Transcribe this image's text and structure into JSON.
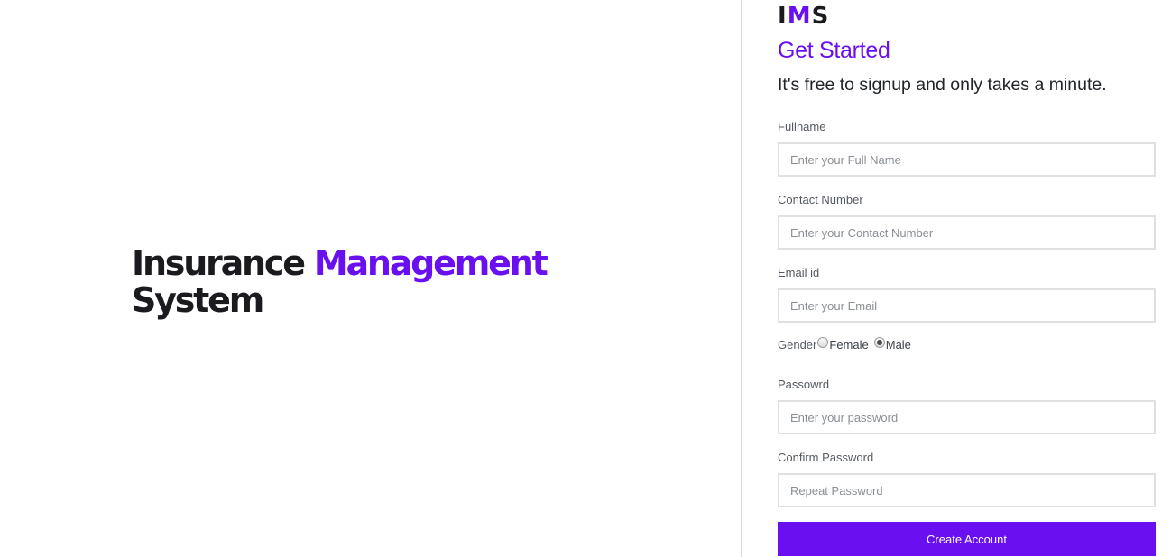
{
  "hero": {
    "title_part1": "Insurance",
    "title_accent": "Management",
    "title_part2": "System"
  },
  "logo": {
    "letter1": "I",
    "letter2": "M",
    "letter3": "S"
  },
  "form": {
    "title": "Get Started",
    "subtitle": "It's free to signup and only takes a minute.",
    "fullname": {
      "label": "Fullname",
      "placeholder": "Enter your Full Name",
      "value": ""
    },
    "contact": {
      "label": "Contact Number",
      "placeholder": "Enter your Contact Number",
      "value": ""
    },
    "email": {
      "label": "Email id",
      "placeholder": "Enter your Email",
      "value": ""
    },
    "gender": {
      "label": "Gender",
      "options": [
        "Female",
        "Male"
      ],
      "selected": "Male"
    },
    "password": {
      "label": "Passowrd",
      "placeholder": "Enter your password",
      "value": ""
    },
    "confirm_password": {
      "label": "Confirm Password",
      "placeholder": "Repeat Password",
      "value": ""
    },
    "submit_label": "Create Account"
  },
  "colors": {
    "accent": "#6a0ff0",
    "text_dark": "#1b1b1f",
    "input_border": "#e0e0e0"
  }
}
